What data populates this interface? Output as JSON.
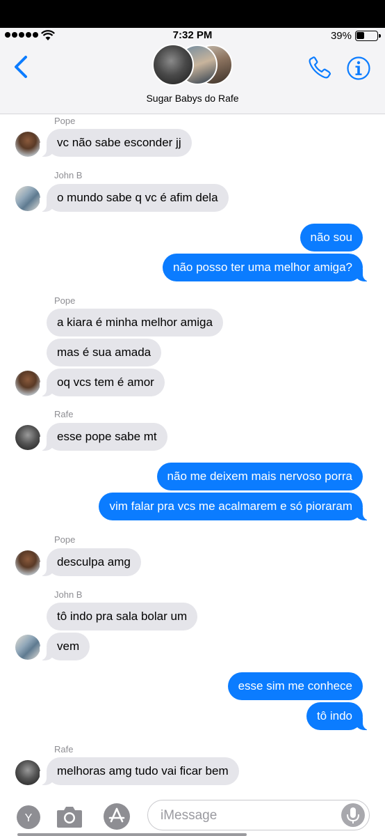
{
  "status_bar": {
    "time": "7:32 PM",
    "battery": "39%",
    "battery_level": 0.39
  },
  "header": {
    "group_name": "Sugar Babys do Rafe",
    "back_icon": "chevron-left-icon",
    "call_icon": "phone-icon",
    "info_icon": "info-icon",
    "accent_color": "#0b7cff"
  },
  "messages": [
    {
      "sender": "Pope",
      "text": "vc não sabe esconder jj",
      "direction": "in"
    },
    {
      "sender": "John B",
      "text": "o mundo sabe q vc é afim dela",
      "direction": "in"
    },
    {
      "text": "não sou",
      "direction": "out"
    },
    {
      "text": "não posso ter uma melhor amiga?",
      "direction": "out"
    },
    {
      "sender": "Pope",
      "text": "a kiara é minha melhor amiga",
      "direction": "in"
    },
    {
      "text": "mas é sua amada",
      "direction": "in"
    },
    {
      "text": "oq vcs tem é amor",
      "direction": "in"
    },
    {
      "sender": "Rafe",
      "text": "esse pope sabe mt",
      "direction": "in"
    },
    {
      "text": "não me deixem mais nervoso porra",
      "direction": "out"
    },
    {
      "text": "vim falar pra vcs me acalmarem e só pioraram",
      "direction": "out"
    },
    {
      "sender": "Pope",
      "text": "desculpa amg",
      "direction": "in"
    },
    {
      "sender": "John B",
      "text": "tô indo pra sala bolar um",
      "direction": "in"
    },
    {
      "text": "vem",
      "direction": "in"
    },
    {
      "text": "esse sim me conhece",
      "direction": "out"
    },
    {
      "text": "tô indo",
      "direction": "out"
    },
    {
      "sender": "Rafe",
      "text": "melhoras amg tudo vai ficar bem",
      "direction": "in"
    }
  ],
  "composer": {
    "app_icon_letter": "Y",
    "placeholder": "iMessage",
    "icons": [
      "camera-icon",
      "app-store-icon",
      "microphone-icon"
    ]
  },
  "colors": {
    "outgoing_bubble": "#0b7cff",
    "incoming_bubble": "#e5e5ea"
  }
}
